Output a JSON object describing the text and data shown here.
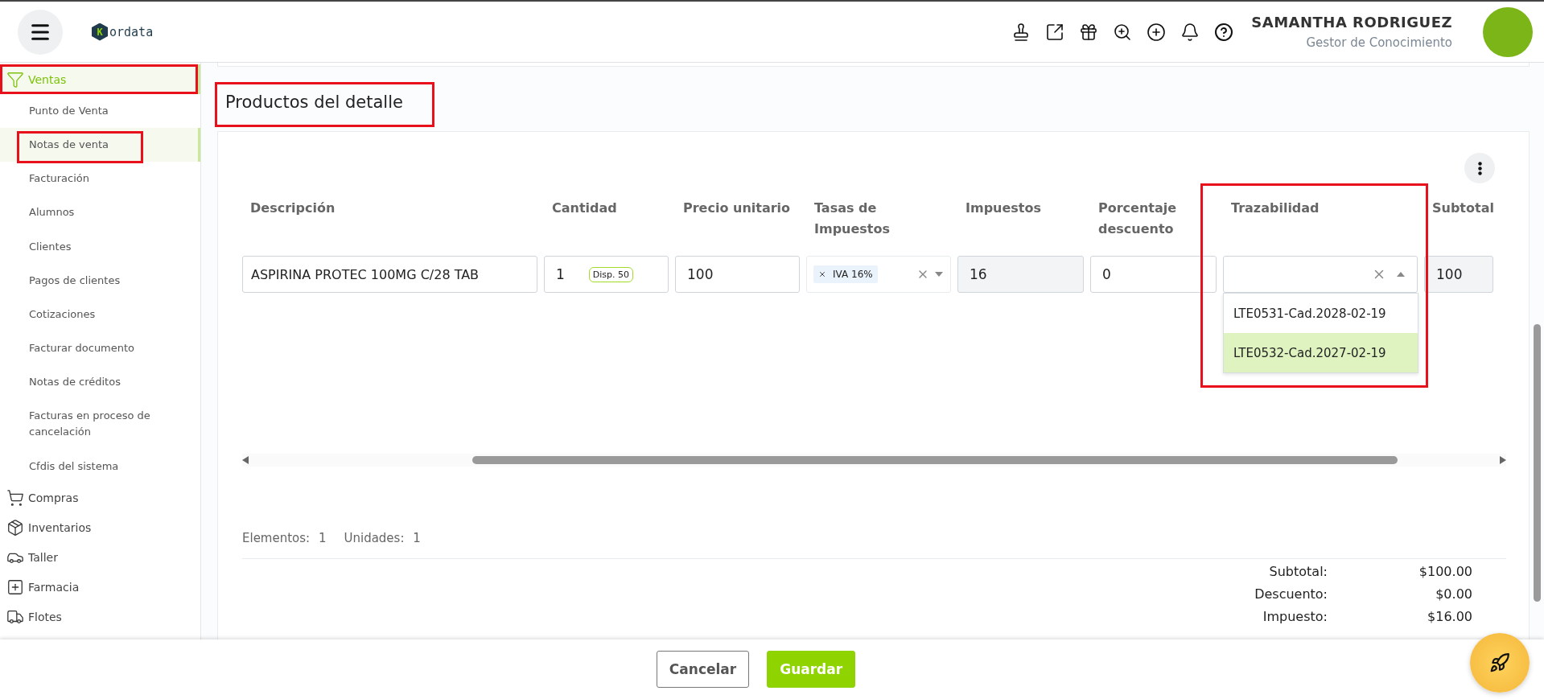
{
  "header": {
    "logo_letter": "K",
    "brand": "ordata",
    "user_name": "SAMANTHA RODRIGUEZ",
    "user_role": "Gestor de Conocimiento"
  },
  "sidebar": {
    "items": [
      {
        "label": "Ventas",
        "expanded": true,
        "annotated": true,
        "children": [
          {
            "label": "Punto de Venta",
            "selected": false,
            "annotated": false
          },
          {
            "label": "Notas de venta",
            "selected": true,
            "annotated": true
          },
          {
            "label": "Facturación",
            "selected": false,
            "annotated": false
          },
          {
            "label": "Alumnos",
            "selected": false,
            "annotated": false
          },
          {
            "label": "Clientes",
            "selected": false,
            "annotated": false
          },
          {
            "label": "Pagos de clientes",
            "selected": false,
            "annotated": false
          },
          {
            "label": "Cotizaciones",
            "selected": false,
            "annotated": false
          },
          {
            "label": "Facturar documento",
            "selected": false,
            "annotated": false
          },
          {
            "label": "Notas de créditos",
            "selected": false,
            "annotated": false
          },
          {
            "label": "Facturas en proceso de cancelación",
            "selected": false,
            "annotated": false
          },
          {
            "label": "Cfdis del sistema",
            "selected": false,
            "annotated": false
          }
        ]
      },
      {
        "label": "Compras",
        "expanded": false,
        "annotated": false
      },
      {
        "label": "Inventarios",
        "expanded": false,
        "annotated": false
      },
      {
        "label": "Taller",
        "expanded": false,
        "annotated": false
      },
      {
        "label": "Farmacia",
        "expanded": false,
        "annotated": false
      },
      {
        "label": "Flotes",
        "expanded": false,
        "annotated": false
      }
    ]
  },
  "section": {
    "title": "Productos del detalle",
    "annotated": true
  },
  "table": {
    "columns": [
      {
        "label": "Descripción",
        "annotated": false
      },
      {
        "label": "Cantidad",
        "annotated": false
      },
      {
        "label": "Precio unitario",
        "annotated": false
      },
      {
        "label": "Tasas de Impuestos",
        "annotated": false
      },
      {
        "label": "Impuestos",
        "annotated": false
      },
      {
        "label": "Porcentaje descuento",
        "annotated": false
      },
      {
        "label": "Trazabilidad",
        "annotated": true
      },
      {
        "label": "Subtotal",
        "annotated": false
      }
    ],
    "row": [
      {
        "kind": "textarea",
        "value": "ASPIRINA PROTEC 100MG C/28 TAB"
      },
      {
        "kind": "quantity",
        "value": "1",
        "badge": "Disp. 50"
      },
      {
        "kind": "input",
        "value": "100"
      },
      {
        "kind": "tags",
        "tags": [
          "IVA 16%"
        ]
      },
      {
        "kind": "readonly",
        "value": "16"
      },
      {
        "kind": "input",
        "value": "0"
      },
      {
        "kind": "select",
        "expanded": true,
        "options": [
          {
            "label": "LTE0531-Cad.2028-02-19",
            "selected": false
          },
          {
            "label": "LTE0532-Cad.2027-02-19",
            "selected": true
          }
        ]
      },
      {
        "kind": "readonly",
        "value": "100"
      }
    ]
  },
  "summary": {
    "counts": [
      {
        "label": "Elementos:",
        "value": "1"
      },
      {
        "label": "Unidades:",
        "value": "1"
      }
    ],
    "totals": [
      {
        "label": "Subtotal:",
        "value": "$100.00"
      },
      {
        "label": "Descuento:",
        "value": "$0.00"
      },
      {
        "label": "Impuesto:",
        "value": "$16.00"
      }
    ]
  },
  "footer": {
    "buttons": [
      {
        "label": "Cancelar",
        "kind": "secondary"
      },
      {
        "label": "Guardar",
        "kind": "primary"
      }
    ]
  }
}
